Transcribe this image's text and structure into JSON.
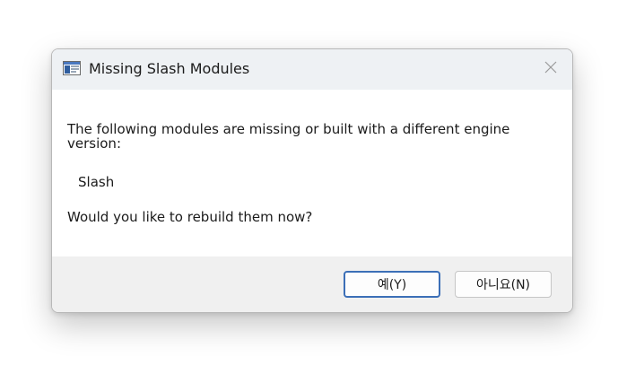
{
  "dialog": {
    "title": "Missing Slash Modules",
    "icon": "application-window-icon",
    "close_icon": "close-icon"
  },
  "message": {
    "intro": "The following modules are missing or built with a different engine version:",
    "modules": [
      "Slash"
    ],
    "question": "Would you like to rebuild them now?"
  },
  "buttons": {
    "yes_label": "예(Y)",
    "no_label": "아니요(N)"
  },
  "colors": {
    "titlebar_bg": "#eef1f4",
    "footer_bg": "#f0f0f0",
    "default_button_border": "#3c6fb7"
  }
}
